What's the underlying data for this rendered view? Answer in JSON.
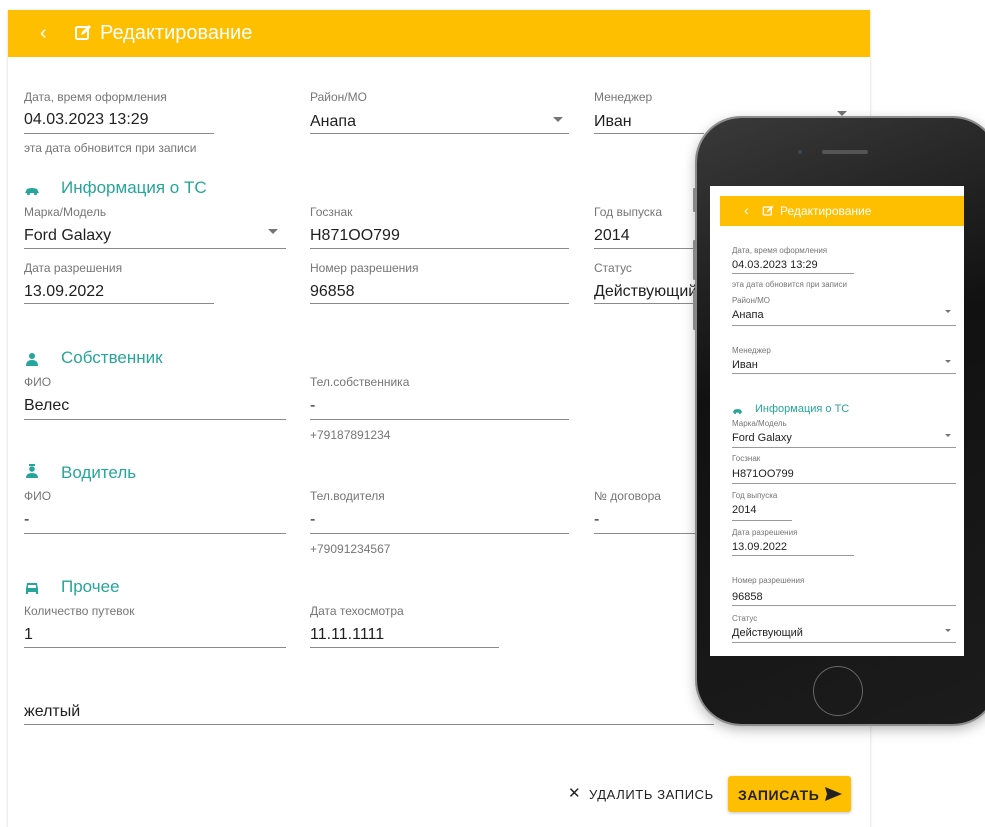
{
  "header": {
    "back_icon": "chevron-left-icon",
    "edit_icon": "edit-icon",
    "title": "Редактирование"
  },
  "form": {
    "date": {
      "label": "Дата, время оформления",
      "value": "04.03.2023 13:29",
      "hint": "эта дата обновится при записи"
    },
    "district": {
      "label": "Район/МО",
      "value": "Анапа"
    },
    "manager": {
      "label": "Менеджер",
      "value": "Иван"
    },
    "vehicle_section": {
      "title": "Информация о ТС",
      "icon": "car-icon"
    },
    "model": {
      "label": "Марка/Модель",
      "value": "Ford Galaxy"
    },
    "plate": {
      "label": "Госзнак",
      "value": "Н871ОО799"
    },
    "year": {
      "label": "Год выпуска",
      "value": "2014"
    },
    "permit_date": {
      "label": "Дата разрешения",
      "value": "13.09.2022"
    },
    "permit_number": {
      "label": "Номер разрешения",
      "value": "96858"
    },
    "status": {
      "label": "Статус",
      "value": "Действующий"
    },
    "owner_section": {
      "title": "Собственник",
      "icon": "person-icon"
    },
    "owner_name": {
      "label": "ФИО",
      "value": "Велес"
    },
    "owner_phone": {
      "label": "Тел.собственника",
      "value": "-",
      "hint": "+79187891234"
    },
    "driver_section": {
      "title": "Водитель",
      "icon": "driver-icon"
    },
    "driver_name": {
      "label": "ФИО",
      "value": "-"
    },
    "driver_phone": {
      "label": "Тел.водителя",
      "value": "-",
      "hint": "+79091234567"
    },
    "contract": {
      "label": "№ договора",
      "value": "-"
    },
    "other_section": {
      "title": "Прочее",
      "icon": "car-front-icon"
    },
    "trips": {
      "label": "Количество путевок",
      "value": "1"
    },
    "inspection": {
      "label": "Дата техосмотра",
      "value": "11.11.1111"
    },
    "color": {
      "value": "желтый"
    }
  },
  "actions": {
    "delete_label": "УДАЛИТЬ ЗАПИСЬ",
    "save_label": "ЗАПИСАТЬ"
  },
  "colors": {
    "accent": "#fdbf00",
    "section": "#26a69a"
  }
}
